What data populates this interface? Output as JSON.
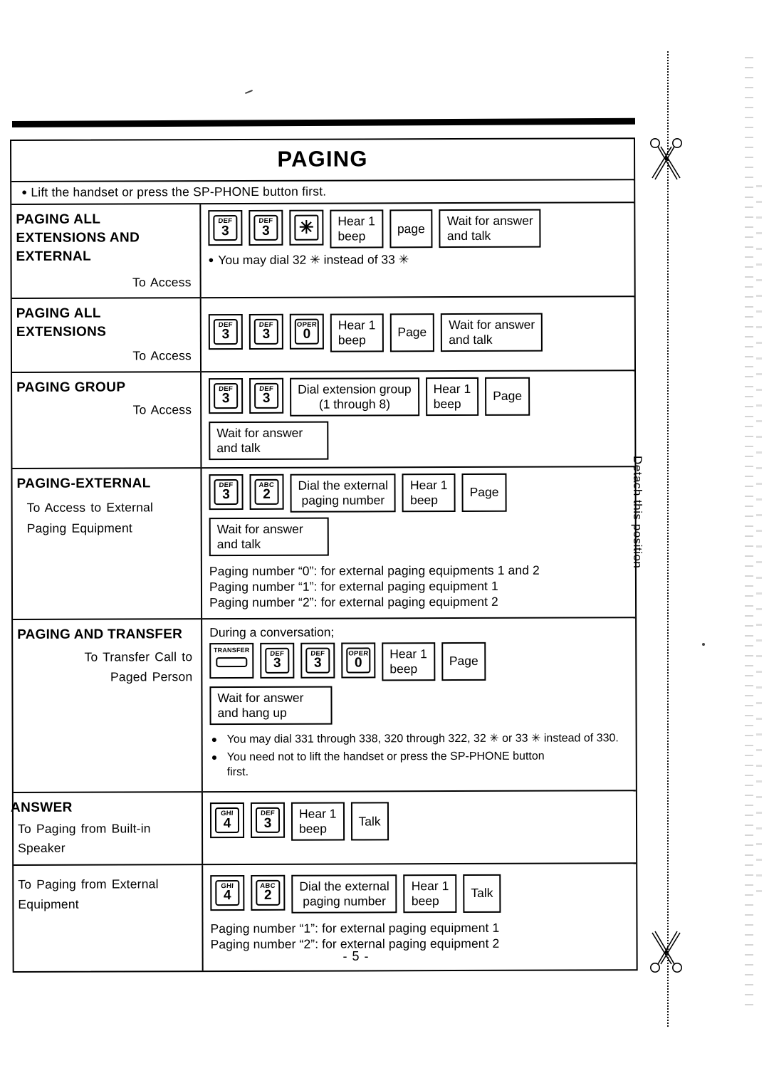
{
  "document": {
    "page_number": "- 5 -",
    "table_title": "PAGING",
    "top_note": "Lift the handset or press the SP-PHONE button first.",
    "top_note_bullet": "●",
    "margin_label": "Detach this position",
    "scissors_icon": "scissors-icon"
  },
  "rows": [
    {
      "id": "paging-all-extensions-and-external",
      "heading": "PAGING ALL\nEXTENSIONS AND\nEXTERNAL",
      "subheading": "To Access",
      "steps": [
        {
          "kind": "key",
          "letters": "DEF",
          "digit": "3"
        },
        {
          "kind": "key",
          "letters": "DEF",
          "digit": "3"
        },
        {
          "kind": "key",
          "letters": "",
          "digit": "✳"
        },
        {
          "kind": "box",
          "text": "Hear 1\nbeep"
        },
        {
          "kind": "box",
          "text": "page"
        },
        {
          "kind": "box",
          "text": "Wait for answer\nand talk"
        }
      ],
      "note": "You may dial 32 ✳ instead of 33 ✳",
      "note_bullet": "●"
    },
    {
      "id": "paging-all-extensions",
      "heading": "PAGING ALL\nEXTENSIONS",
      "subheading": "To Access",
      "steps": [
        {
          "kind": "key",
          "letters": "DEF",
          "digit": "3"
        },
        {
          "kind": "key",
          "letters": "DEF",
          "digit": "3"
        },
        {
          "kind": "key",
          "letters": "OPER",
          "digit": "0"
        },
        {
          "kind": "box",
          "text": "Hear 1\nbeep"
        },
        {
          "kind": "box",
          "text": "Page"
        },
        {
          "kind": "box",
          "text": "Wait for answer\nand talk"
        }
      ]
    },
    {
      "id": "paging-group",
      "heading": "PAGING GROUP",
      "subheading": "To Access",
      "steps": [
        {
          "kind": "key",
          "letters": "DEF",
          "digit": "3"
        },
        {
          "kind": "key",
          "letters": "DEF",
          "digit": "3"
        },
        {
          "kind": "box",
          "text": "Dial extension group\n(1 through 8)",
          "center": true
        },
        {
          "kind": "box",
          "text": "Hear 1\nbeep"
        },
        {
          "kind": "box",
          "text": "Page"
        }
      ],
      "steps2": [
        {
          "kind": "box",
          "text": "Wait for answer\nand talk"
        }
      ]
    },
    {
      "id": "paging-external",
      "heading": "PAGING-EXTERNAL",
      "subheading": "To Access to External\nPaging Equipment",
      "steps": [
        {
          "kind": "key",
          "letters": "DEF",
          "digit": "3"
        },
        {
          "kind": "key",
          "letters": "ABC",
          "digit": "2"
        },
        {
          "kind": "box",
          "text": "Dial the external\npaging number",
          "center": true
        },
        {
          "kind": "box",
          "text": "Hear 1\nbeep"
        },
        {
          "kind": "box",
          "text": "Page"
        }
      ],
      "steps2": [
        {
          "kind": "box",
          "text": "Wait for answer\nand talk"
        }
      ],
      "footnote": "Paging number “0”: for external paging equipments 1 and 2\nPaging number “1”: for external paging equipment 1\nPaging number “2”: for external paging equipment 2"
    },
    {
      "id": "paging-and-transfer",
      "heading": "PAGING AND TRANSFER",
      "subheading": "To Transfer Call to\nPaged Person",
      "lead": "During a conversation;",
      "steps": [
        {
          "kind": "fnkey",
          "label": "TRANSFER"
        },
        {
          "kind": "key",
          "letters": "DEF",
          "digit": "3"
        },
        {
          "kind": "key",
          "letters": "DEF",
          "digit": "3"
        },
        {
          "kind": "key",
          "letters": "OPER",
          "digit": "0"
        },
        {
          "kind": "box",
          "text": "Hear 1\nbeep"
        },
        {
          "kind": "box",
          "text": "Page"
        }
      ],
      "steps2": [
        {
          "kind": "box",
          "text": "Wait for answer\nand hang up"
        }
      ],
      "bullets": [
        "You may dial 331 through 338, 320 through 322, 32 ✳ or 33 ✳ instead of 330.",
        "You need not to lift the handset or press the SP-PHONE button\nfirst."
      ],
      "bullet_glyph": "●"
    },
    {
      "id": "answer-built-in-speaker",
      "heading": "ANSWER",
      "subheading": "To Paging from Built-in\nSpeaker",
      "steps": [
        {
          "kind": "key",
          "letters": "GHI",
          "digit": "4"
        },
        {
          "kind": "key",
          "letters": "DEF",
          "digit": "3"
        },
        {
          "kind": "box",
          "text": "Hear 1\nbeep"
        },
        {
          "kind": "box",
          "text": "Talk"
        }
      ]
    },
    {
      "id": "answer-external-equipment",
      "heading": "",
      "subheading": "To Paging from External\nEquipment",
      "steps": [
        {
          "kind": "key",
          "letters": "GHI",
          "digit": "4"
        },
        {
          "kind": "key",
          "letters": "ABC",
          "digit": "2"
        },
        {
          "kind": "box",
          "text": "Dial the external\npaging number",
          "center": true
        },
        {
          "kind": "box",
          "text": "Hear 1\nbeep"
        },
        {
          "kind": "box",
          "text": "Talk"
        }
      ],
      "footnote": "Paging number “1”: for external paging equipment 1\nPaging number “2”: for external paging equipment 2"
    }
  ]
}
